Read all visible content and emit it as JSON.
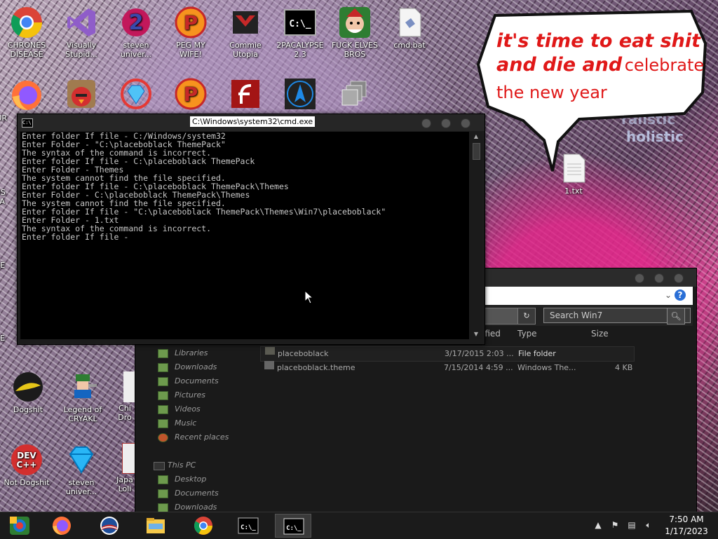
{
  "desktop": {
    "icons": [
      {
        "label_lines": [
          "CHRONES",
          "DISEASE"
        ]
      },
      {
        "label_lines": [
          "Visually",
          "Stupid..."
        ]
      },
      {
        "label_lines": [
          "steven",
          "univer..."
        ]
      },
      {
        "label_lines": [
          "PEG MY WIFE!"
        ]
      },
      {
        "label_lines": [
          "Commie",
          "Utopia"
        ]
      },
      {
        "label_lines": [
          "2PACALYPSE",
          "2.3"
        ]
      },
      {
        "label_lines": [
          "FUCK ELVES",
          "BROS"
        ]
      },
      {
        "label_lines": [
          "cmd.bat"
        ]
      },
      {
        "label_lines": [
          "1.txt"
        ]
      },
      {
        "label_lines": [
          "Dogshit"
        ]
      },
      {
        "label_lines": [
          "Legend of",
          "CRYAKL"
        ]
      },
      {
        "label_lines": [
          "Not Dogshit"
        ]
      },
      {
        "label_lines": [
          "steven",
          "univer..."
        ]
      }
    ],
    "partial_labels": {
      "left_fur": "FUR",
      "left_os": "OS",
      "left_la": "LA",
      "left_be": "BE",
      "left_se": "SE",
      "chi": "Chi",
      "dro": "Dro",
      "japa": "Japa",
      "loli": "Loli"
    },
    "bubble": {
      "line1": "it's time to eat shit",
      "line2_bold": "and die and",
      "line2_rest": "celebrate",
      "line3": "the new year"
    },
    "wallpaper_text": {
      "word1": "holistic",
      "word2": "ralistic"
    }
  },
  "cmd_window": {
    "title": "C:\\Windows\\system32\\cmd.exe",
    "lines": [
      "Enter folder If file - C:/Windows/system32",
      "Enter Folder - \"C:\\placeboblack ThemePack\"",
      "The syntax of the command is incorrect.",
      "Enter folder If file - C:\\placeboblack ThemePack",
      "Enter Folder - Themes",
      "The system cannot find the file specified.",
      "Enter folder If file - C:\\placeboblack ThemePack\\Themes",
      "Enter Folder - C:\\placeboblack ThemePack\\Themes",
      "The system cannot find the file specified.",
      "Enter folder If file - \"C:\\placeboblack ThemePack\\Themes\\Win7\\placeboblack\"",
      "Enter Folder - 1.txt",
      "The syntax of the command is incorrect.",
      "Enter folder If file -"
    ]
  },
  "explorer": {
    "search_placeholder": "Search Win7",
    "columns": {
      "modified": "ified",
      "type": "Type",
      "size": "Size"
    },
    "nav_items": [
      "Libraries",
      "Downloads",
      "Documents",
      "Pictures",
      "Videos",
      "Music",
      "Recent places"
    ],
    "this_pc": "This PC",
    "pc_items": [
      "Desktop",
      "Documents",
      "Downloads"
    ],
    "files": [
      {
        "name": "placeboblack",
        "date": "3/17/2015 2:03 ...",
        "type": "File folder",
        "size": ""
      },
      {
        "name": "placeboblack.theme",
        "date": "7/15/2014 4:59 ...",
        "type": "Windows The...",
        "size": "4 KB"
      }
    ]
  },
  "taskbar": {
    "apps": [
      "color-app",
      "firefox",
      "obama-app",
      "file-explorer",
      "chrome",
      "cmd",
      "cmd-active"
    ],
    "clock_time": "7:50 AM",
    "clock_date": "1/17/2023"
  }
}
